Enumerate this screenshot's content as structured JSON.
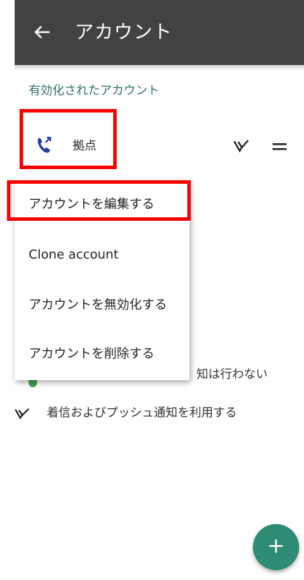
{
  "appbar": {
    "title": "アカウント",
    "back_icon": "arrow-left-icon",
    "background": "#424242"
  },
  "section": {
    "header": "有効化されたアカウント",
    "color": "#2f6e6a"
  },
  "account": {
    "name": "拠点",
    "icon": "phone-call-icon",
    "push_icon": "v-push-icon",
    "drag_icon": "drag-handle-icon"
  },
  "menu": {
    "items": [
      "アカウントを編集する",
      "Clone account",
      "アカウントを無効化する",
      "アカウントを削除する"
    ]
  },
  "legend": {
    "no_push_tail": "知は行わない",
    "push": "着信およびプッシュ通知を利用する"
  },
  "fab": {
    "label": "+",
    "color": "#2e8b74"
  },
  "highlight_color": "#ff0000"
}
